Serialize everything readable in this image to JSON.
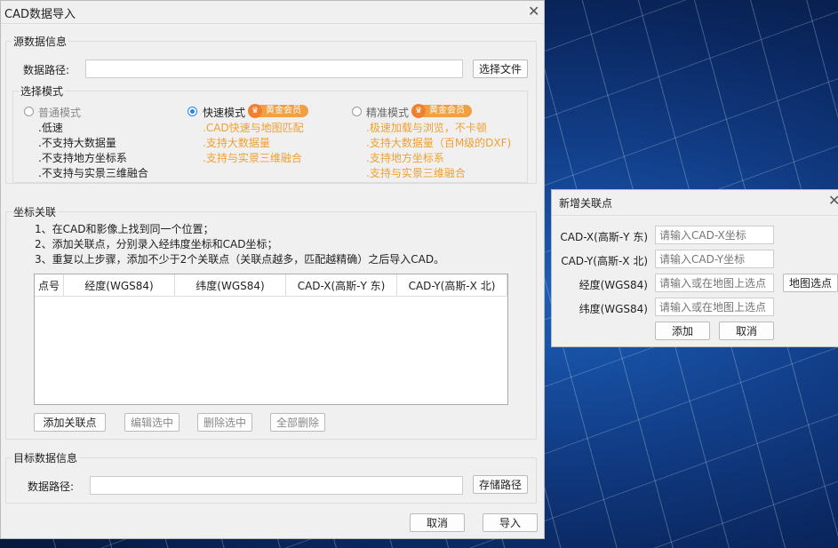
{
  "main": {
    "title": "CAD数据导入",
    "close": "✕",
    "source": {
      "title": "源数据信息",
      "path_label": "数据路径:",
      "path_value": "",
      "select_button": "选择文件"
    },
    "mode": {
      "title": "选择模式",
      "badge": "黄金会员",
      "crown": "♛",
      "options": [
        {
          "label": "普通模式",
          "selected": false,
          "features": [
            ".低速",
            ".不支持大数据量",
            ".不支持地方坐标系",
            ".不支持与实景三维融合"
          ]
        },
        {
          "label": "快速模式",
          "selected": true,
          "features": [
            ".CAD快速与地图匹配",
            ".支持大数据量",
            ".支持与实景三维融合"
          ]
        },
        {
          "label": "精准模式",
          "selected": false,
          "features": [
            ".极速加载与浏览，不卡顿",
            ".支持大数据量（百M级的DXF)",
            ".支持地方坐标系",
            ".支持与实景三维融合"
          ]
        }
      ]
    },
    "coord": {
      "title": "坐标关联",
      "steps": [
        "1、在CAD和影像上找到同一个位置；",
        "2、添加关联点，分别录入经纬度坐标和CAD坐标；",
        "3、重复以上步骤，添加不少于2个关联点（关联点越多，匹配越精确）之后导入CAD。"
      ],
      "columns": [
        "点号",
        "经度(WGS84)",
        "纬度(WGS84)",
        "CAD-X(高斯-Y 东)",
        "CAD-Y(高斯-X 北)"
      ],
      "buttons": {
        "add": "添加关联点",
        "edit": "编辑选中",
        "delete": "删除选中",
        "delete_all": "全部删除"
      }
    },
    "target": {
      "title": "目标数据信息",
      "path_label": "数据路径:",
      "path_value": "",
      "save_button": "存储路径"
    },
    "cancel": "取消",
    "import": "导入"
  },
  "add_point": {
    "title": "新增关联点",
    "close": "✕",
    "fields": [
      {
        "label": "CAD-X(高斯-Y 东)",
        "placeholder": "请输入CAD-X坐标"
      },
      {
        "label": "CAD-Y(高斯-X 北)",
        "placeholder": "请输入CAD-Y坐标"
      },
      {
        "label": "经度(WGS84)",
        "placeholder": "请输入或在地图上选点"
      },
      {
        "label": "纬度(WGS84)",
        "placeholder": "请输入或在地图上选点"
      }
    ],
    "map_pick": "地图选点",
    "add": "添加",
    "cancel": "取消"
  }
}
